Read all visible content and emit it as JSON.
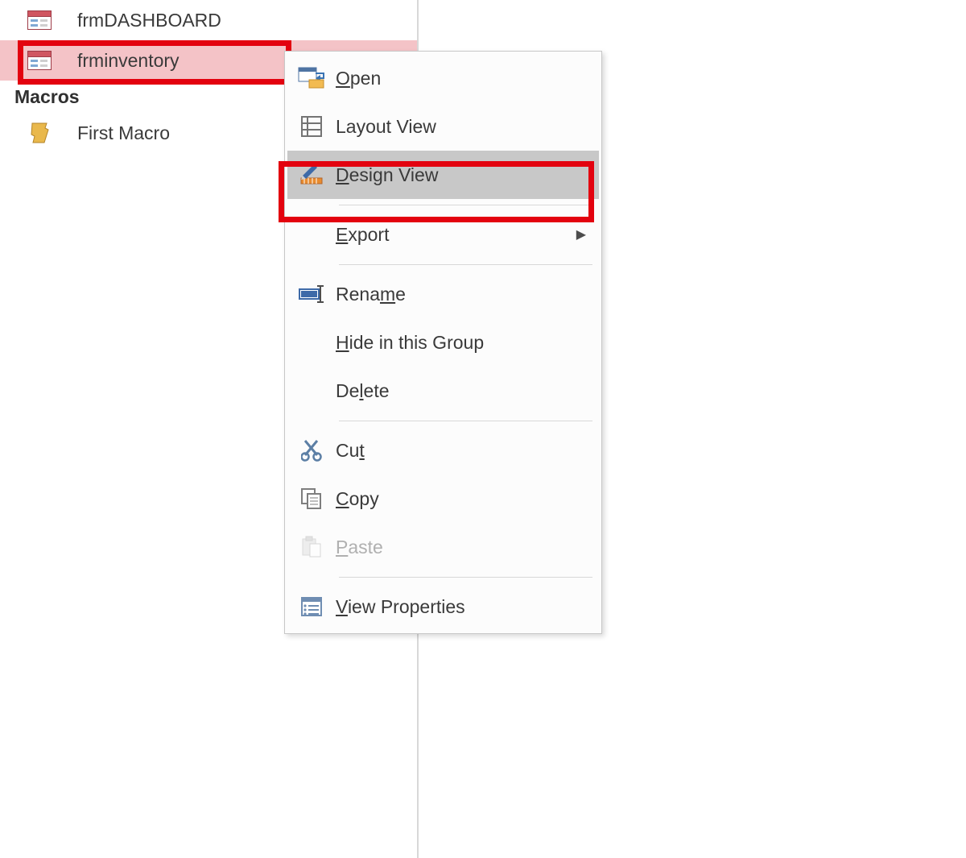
{
  "nav": {
    "forms": [
      {
        "label": "frmDASHBOARD"
      },
      {
        "label": "frminventory",
        "selected": true
      }
    ],
    "group": "Macros",
    "macros": [
      {
        "label": "First Macro"
      }
    ]
  },
  "menu": {
    "open": "Open",
    "layout_view": "Layout View",
    "design_view": "Design View",
    "export": "Export",
    "rename": "Rename",
    "hide": "Hide in this Group",
    "delete": "Delete",
    "cut": "Cut",
    "copy": "Copy",
    "paste": "Paste",
    "view_properties": "View Properties"
  }
}
